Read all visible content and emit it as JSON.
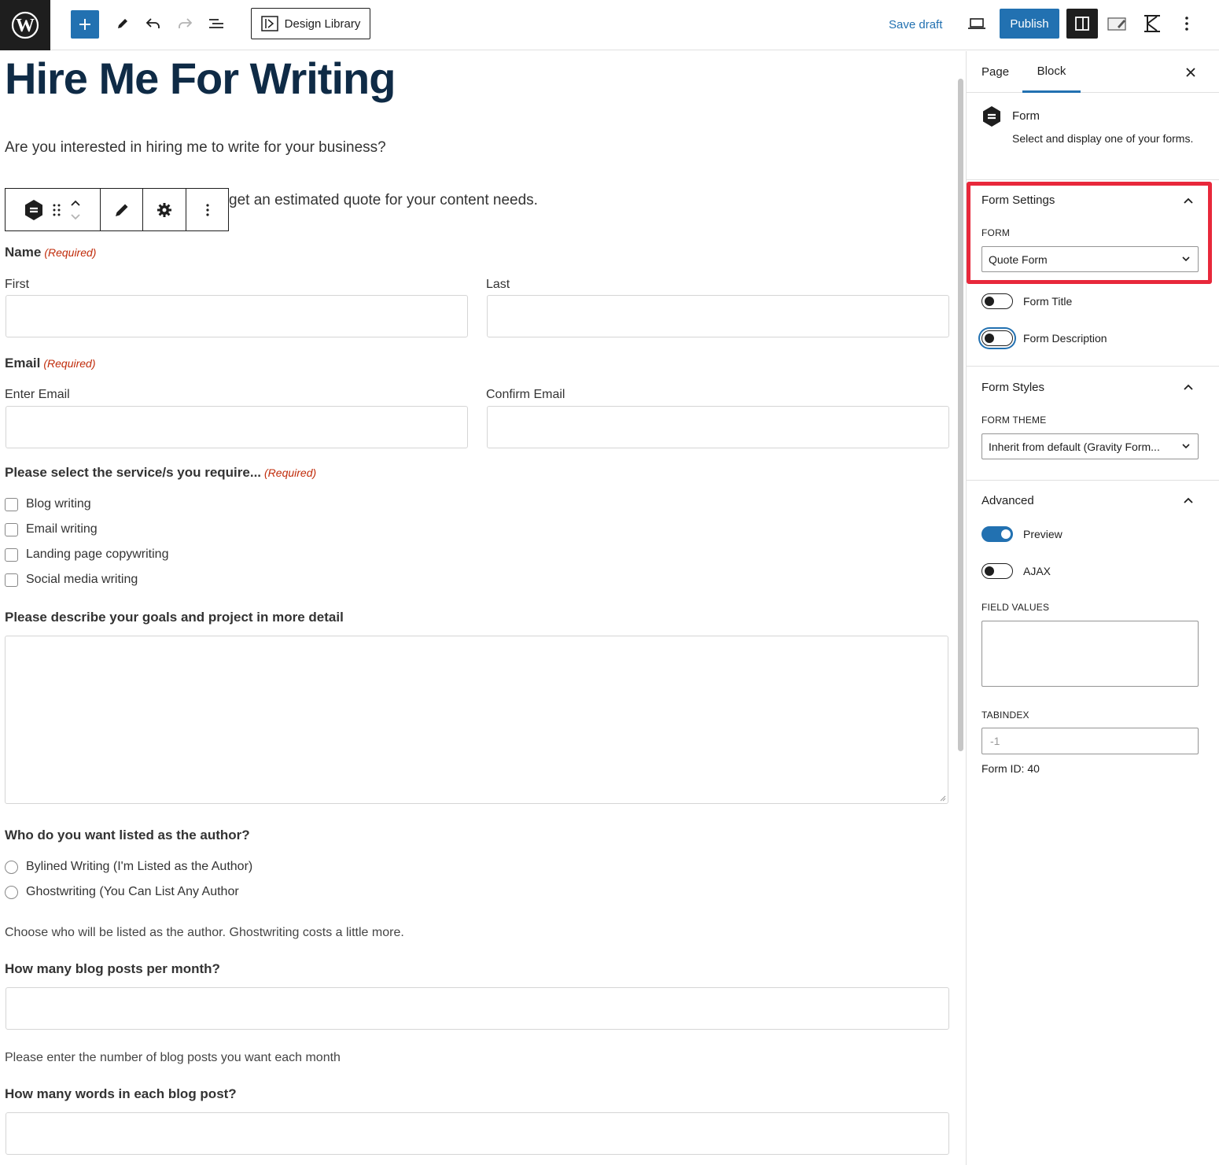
{
  "toolbar": {
    "wordpress_logo": "wordpress-logo",
    "design_library_label": "Design Library",
    "save_draft_label": "Save draft",
    "publish_label": "Publish",
    "accent_color": "#2271b1"
  },
  "editor": {
    "page_title": "Hire Me For Writing",
    "intro_paragraph": "Are you interested in hiring me to write for your business?",
    "second_paragraph": "get an estimated quote for your content needs.",
    "form": {
      "name_label": "Name",
      "required_text": "(Required)",
      "first_label": "First",
      "last_label": "Last",
      "email_label": "Email",
      "enter_email_label": "Enter Email",
      "confirm_email_label": "Confirm Email",
      "services_label": "Please select the service/s you require...",
      "services": [
        "Blog writing",
        "Email writing",
        "Landing page copywriting",
        "Social media writing"
      ],
      "goals_label": "Please describe your goals and project in more detail",
      "author_label": "Who do you want listed as the author?",
      "author_options": [
        "Bylined Writing (I'm Listed as the Author)",
        "Ghostwriting (You Can List Any Author"
      ],
      "author_description": "Choose who will be listed as the author. Ghostwriting costs a little more.",
      "posts_label": "How many blog posts per month?",
      "posts_description": "Please enter the number of blog posts you want each month",
      "words_label": "How many words in each blog post?"
    }
  },
  "sidebar": {
    "tabs": [
      "Page",
      "Block"
    ],
    "active_tab": "Block",
    "block_name": "Form",
    "block_description": "Select and display one of your forms.",
    "form_settings": {
      "heading": "Form Settings",
      "form_label": "FORM",
      "form_value": "Quote Form",
      "toggles": [
        {
          "label": "Form Title",
          "on": false
        },
        {
          "label": "Form Description",
          "on": false
        }
      ]
    },
    "form_styles": {
      "heading": "Form Styles",
      "theme_label": "FORM THEME",
      "theme_value": "Inherit from default (Gravity Form..."
    },
    "advanced": {
      "heading": "Advanced",
      "toggles": [
        {
          "label": "Preview",
          "on": true
        },
        {
          "label": "AJAX",
          "on": false
        }
      ],
      "field_values_label": "FIELD VALUES",
      "tabindex_label": "TABINDEX",
      "tabindex_placeholder": "-1",
      "form_id_text": "Form ID: 40"
    },
    "highlight_color": "#e8283b"
  }
}
